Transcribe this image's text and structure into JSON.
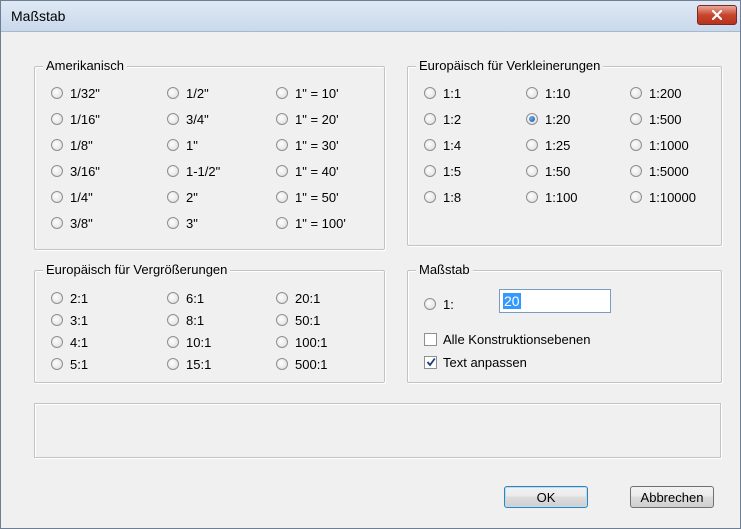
{
  "window": {
    "title": "Maßstab"
  },
  "amerikanisch": {
    "legend": "Amerikanisch",
    "options": [
      "1/32\"",
      "1/2\"",
      "1\" = 10'",
      "1/16\"",
      "3/4\"",
      "1\" = 20'",
      "1/8\"",
      "1\"",
      "1\" = 30'",
      "3/16\"",
      "1-1/2\"",
      "1\" = 40'",
      "1/4\"",
      "2\"",
      "1\" = 50'",
      "3/8\"",
      "3\"",
      "1\" = 100'"
    ]
  },
  "verkleinerung": {
    "legend": "Europäisch für Verkleinerungen",
    "options": [
      "1:1",
      "1:10",
      "1:200",
      "1:2",
      "1:20",
      "1:500",
      "1:4",
      "1:25",
      "1:1000",
      "1:5",
      "1:50",
      "1:5000",
      "1:8",
      "1:100",
      "1:10000"
    ],
    "selected": "1:20"
  },
  "vergroesserung": {
    "legend": "Europäisch für Vergrößerungen",
    "options": [
      "2:1",
      "6:1",
      "20:1",
      "3:1",
      "8:1",
      "50:1",
      "4:1",
      "10:1",
      "100:1",
      "5:1",
      "15:1",
      "500:1"
    ]
  },
  "massstab": {
    "legend": "Maßstab",
    "custom_label": "1:",
    "custom_value": "20",
    "all_layers_label": "Alle Konstruktionsebenen",
    "all_layers_checked": false,
    "adjust_text_label": "Text anpassen",
    "adjust_text_checked": true
  },
  "buttons": {
    "ok": "OK",
    "cancel": "Abbrechen"
  },
  "icons": {
    "close": "close-icon",
    "radio": "radio-button",
    "checkbox": "checkbox"
  },
  "colors": {
    "selection": "#3399ff",
    "close_button": "#c7452e",
    "dialog_bg": "#f0f0f0"
  }
}
